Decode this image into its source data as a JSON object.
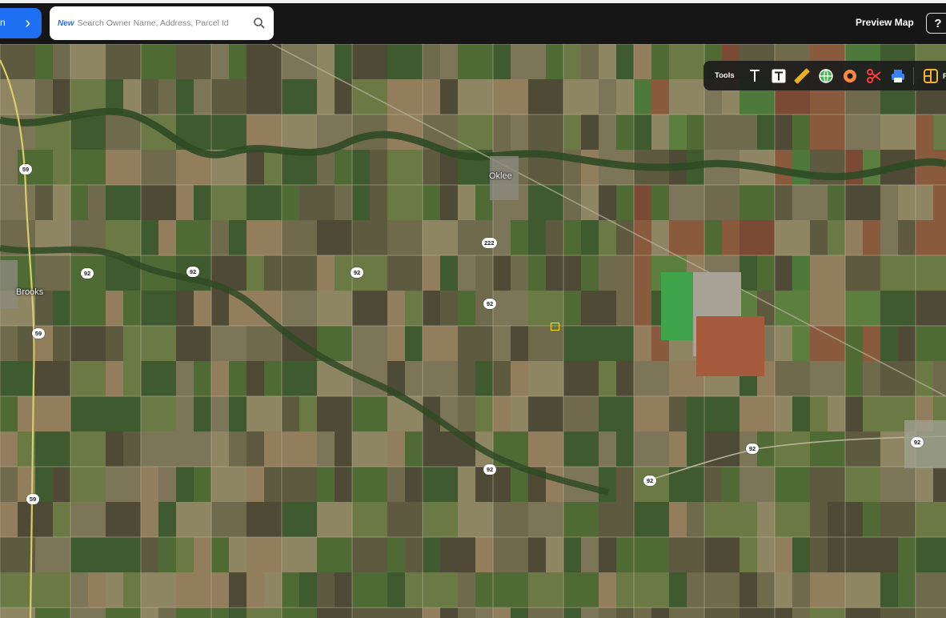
{
  "header": {
    "nav_partial_label": "n",
    "nav_chevron": "›",
    "search": {
      "tag": "New",
      "placeholder": "Search Owner Name, Address, Parcel Id"
    },
    "preview_label": "Preview Map",
    "help_label": "?"
  },
  "toolbar": {
    "label": "Tools",
    "cut_text": "Pa",
    "items": [
      {
        "name": "text-tool-icon"
      },
      {
        "name": "text-box-tool-icon"
      },
      {
        "name": "measure-tool-icon"
      },
      {
        "name": "globe-tool-icon"
      },
      {
        "name": "buffer-tool-icon"
      },
      {
        "name": "scissors-tool-icon"
      },
      {
        "name": "print-tool-icon"
      },
      {
        "name": "panel-tool-icon"
      }
    ],
    "colors": {
      "text": "#ffffff",
      "measure": "#e6b422",
      "globe": "#4caf50",
      "buffer": "#ff8a3d",
      "scissors": "#ff3b3b",
      "print": "#3b82f6",
      "panel": "#f0b429"
    }
  },
  "map": {
    "towns": [
      {
        "name": "Oklee"
      },
      {
        "name": "Brooks"
      }
    ],
    "shields": [
      {
        "label": "222"
      },
      {
        "label": "92"
      },
      {
        "label": "92"
      },
      {
        "label": "92"
      },
      {
        "label": "92"
      },
      {
        "label": "92"
      },
      {
        "label": "92"
      },
      {
        "label": "92"
      },
      {
        "label": "92"
      },
      {
        "label": "59"
      },
      {
        "label": "59"
      },
      {
        "label": "59"
      }
    ],
    "colors": {
      "base": "#6f6a4c",
      "field_light": "#8e8563",
      "field_dark": "#4e4a35",
      "field_green": "#4f6a35",
      "forest": "#2f4a25",
      "road": "#b8b39a",
      "highway": "#d8cf6a",
      "marker": "#f5e311"
    }
  },
  "colors": {
    "topbar": "#161616",
    "accent": "#1e6ff2"
  }
}
